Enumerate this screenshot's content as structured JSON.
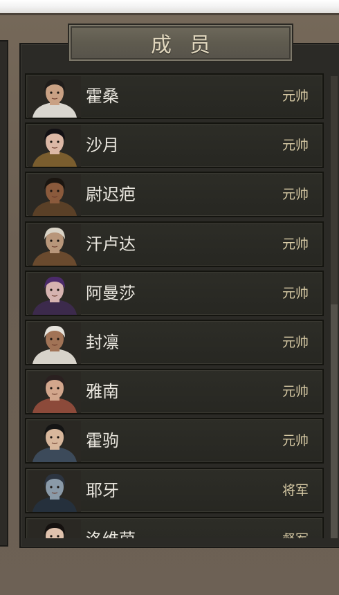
{
  "panel": {
    "title": "成员"
  },
  "members": [
    {
      "name": "霍桑",
      "rank": "元帅",
      "portrait": "portrait-huosang",
      "hair": "#1f1c1a",
      "skin": "#c9a184",
      "cloth": "#d9d6cf"
    },
    {
      "name": "沙月",
      "rank": "元帅",
      "portrait": "portrait-shayue",
      "hair": "#121014",
      "skin": "#dcb8a6",
      "cloth": "#7a5d2e"
    },
    {
      "name": "尉迟疤",
      "rank": "元帅",
      "portrait": "portrait-yuchiba",
      "hair": "#1a1510",
      "skin": "#8a5a3c",
      "cloth": "#5a4027"
    },
    {
      "name": "汗卢达",
      "rank": "元帅",
      "portrait": "portrait-hanluda",
      "hair": "#d9d3c6",
      "skin": "#b8967a",
      "cloth": "#6a4a2e"
    },
    {
      "name": "阿曼莎",
      "rank": "元帅",
      "portrait": "portrait-amansha",
      "hair": "#4b2a6a",
      "skin": "#d6b3b0",
      "cloth": "#3c2a4c"
    },
    {
      "name": "封凛",
      "rank": "元帅",
      "portrait": "portrait-fenglin",
      "hair": "#e6e3dc",
      "skin": "#a17356",
      "cloth": "#d7d3ca"
    },
    {
      "name": "雅南",
      "rank": "元帅",
      "portrait": "portrait-yanan",
      "hair": "#2a2020",
      "skin": "#d2a68c",
      "cloth": "#8c4a3a"
    },
    {
      "name": "霍驹",
      "rank": "元帅",
      "portrait": "portrait-huoju",
      "hair": "#141414",
      "skin": "#d8b79c",
      "cloth": "#3c4a5a"
    },
    {
      "name": "耶牙",
      "rank": "将军",
      "portrait": "portrait-yeya",
      "hair": "#2c3440",
      "skin": "#8a9aa8",
      "cloth": "#25303c"
    },
    {
      "name": "洛维茵",
      "rank": "督军",
      "portrait": "portrait-luoweiyin",
      "hair": "#15110f",
      "skin": "#e0c2ad",
      "cloth": "#c9c5bd"
    }
  ],
  "colors": {
    "name_text": "#e9e6de",
    "rank_text": "#d6c9a4",
    "title_text": "#e0d6bd"
  }
}
